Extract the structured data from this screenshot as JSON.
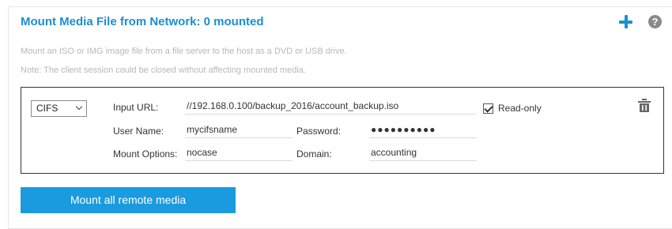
{
  "header": {
    "title": "Mount Media File from Network: 0 mounted",
    "help_symbol": "?"
  },
  "description": {
    "line1": "Mount an ISO or IMG image file from a file server to the host as a DVD or USB drive.",
    "line2": "Note: The client session could be closed without affecting mounted media."
  },
  "media": {
    "protocol": "CIFS",
    "input_url_label": "Input URL:",
    "input_url": "//192.168.0.100/backup_2016/account_backup.iso",
    "readonly_label": "Read-only",
    "readonly_checked": true,
    "user_name_label": "User Name:",
    "user_name": "mycifsname",
    "password_label": "Password:",
    "password": "●●●●●●●●●●",
    "mount_options_label": "Mount Options:",
    "mount_options": "nocase",
    "domain_label": "Domain:",
    "domain": "accounting"
  },
  "actions": {
    "mount_all": "Mount all remote media"
  },
  "icons": {
    "add": "plus-icon",
    "help": "help-icon",
    "delete": "trash-icon",
    "dropdown": "chevron-down-icon"
  },
  "colors": {
    "accent": "#1a8fd1",
    "button": "#1a9be0",
    "muted_text": "#b8b8b8"
  }
}
